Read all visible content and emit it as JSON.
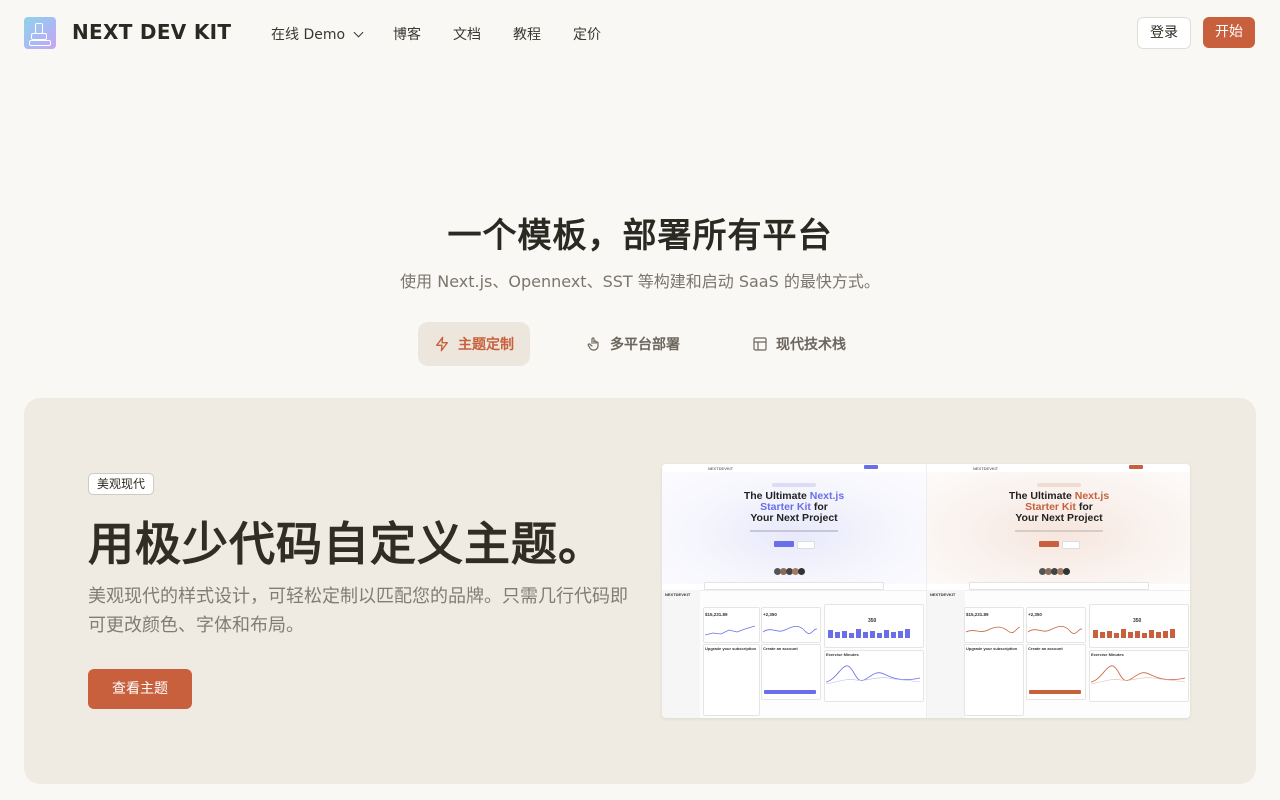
{
  "header": {
    "brand": "NEXT DEV KIT",
    "nav": [
      "在线 Demo",
      "博客",
      "文档",
      "教程",
      "定价"
    ],
    "login": "登录",
    "start": "开始"
  },
  "hero": {
    "title": "一个模板，部署所有平台",
    "subtitle": "使用 Next.js、Opennext、SST 等构建和启动 SaaS 的最快方式。"
  },
  "tabs": [
    {
      "label": "主题定制",
      "icon": "lightning-icon",
      "active": true
    },
    {
      "label": "多平台部署",
      "icon": "pointer-hand-icon",
      "active": false
    },
    {
      "label": "现代技术栈",
      "icon": "layout-icon",
      "active": false
    }
  ],
  "feature": {
    "badge": "美观现代",
    "title": "用极少代码自定义主题。",
    "description": "美观现代的样式设计，可轻松定制以匹配您的品牌。只需几行代码即可更改颜色、字体和布局。",
    "button": "查看主题"
  },
  "preview": {
    "left_title_lines": [
      "The Ultimate",
      "Next.js",
      "Starter Kit",
      "for",
      "Your Next Project"
    ],
    "right_title_lines": [
      "The Ultimate",
      "Next.js",
      "Starter Kit",
      "for",
      "Your Next Project"
    ],
    "stat_revenue": "$15,231.89",
    "stat_left_2": "+2,350",
    "stat_right_2": "+2,350",
    "stat_goal": "350",
    "card_subscription": "Upgrade your subscription",
    "card_account": "Create an account",
    "card_exercise": "Exercise Minutes",
    "brand_mini": "NEXTDEVKIT",
    "accent_left": "#6a6ee8",
    "accent_right": "#c8603d"
  },
  "colors": {
    "accent": "#c8603d",
    "background": "#faf8f4",
    "card_bg": "#efebe3"
  }
}
